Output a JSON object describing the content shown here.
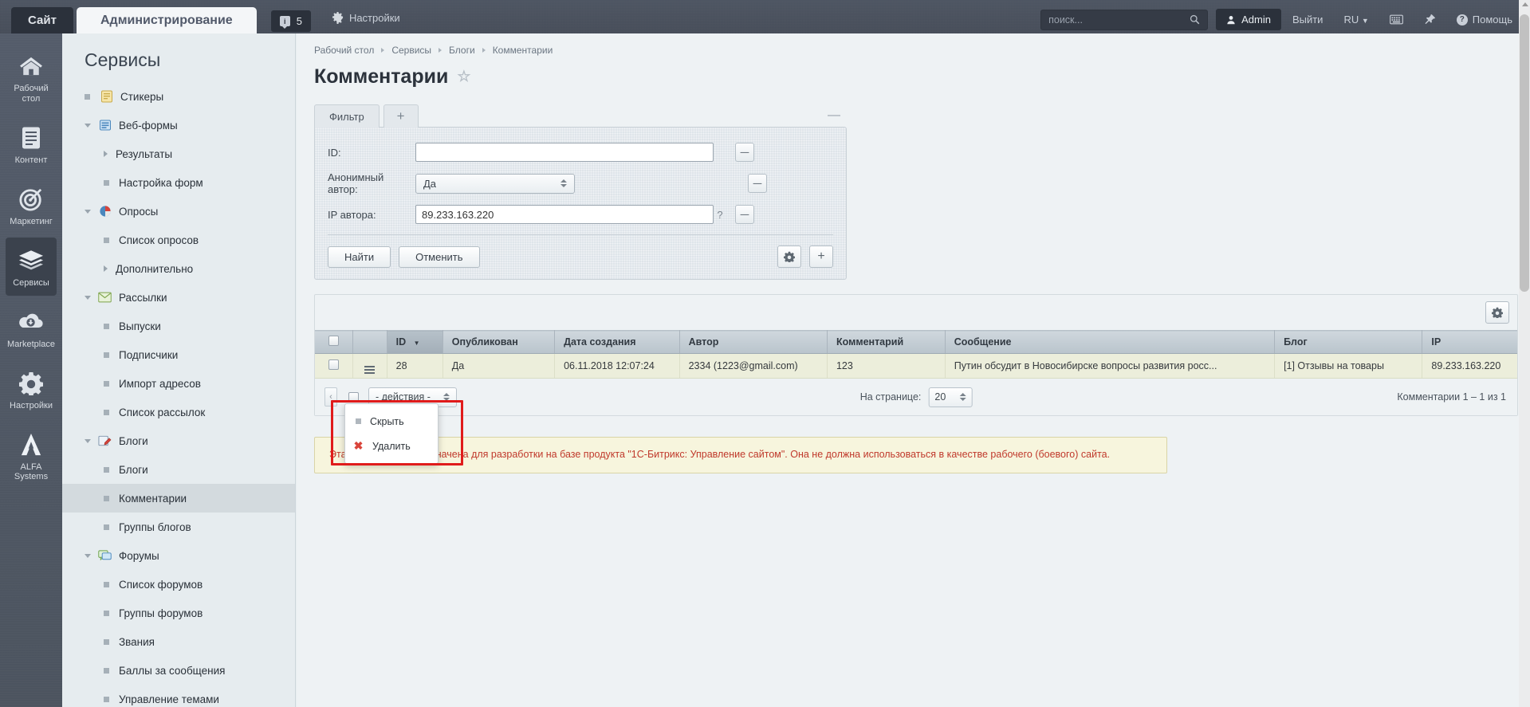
{
  "header": {
    "site_tab": "Сайт",
    "admin_tab": "Администрирование",
    "notif_count": "5",
    "settings_label": "Настройки",
    "search_placeholder": "поиск...",
    "user_label": "Admin",
    "logout_label": "Выйти",
    "lang_label": "RU",
    "help_label": "Помощь"
  },
  "rail": [
    {
      "label": "Рабочий стол",
      "icon": "home-icon"
    },
    {
      "label": "Контент",
      "icon": "document-icon"
    },
    {
      "label": "Маркетинг",
      "icon": "target-icon"
    },
    {
      "label": "Сервисы",
      "icon": "layers-icon"
    },
    {
      "label": "Marketplace",
      "icon": "cloud-download-icon"
    },
    {
      "label": "Настройки",
      "icon": "gear-icon"
    },
    {
      "label": "ALFA Systems",
      "icon": "alfa-logo-icon"
    }
  ],
  "menu": {
    "title": "Сервисы",
    "items": [
      {
        "label": "Стикеры",
        "level": 0,
        "marker": "bullet",
        "icon": "sticker-icon",
        "selected": false
      },
      {
        "label": "Веб-формы",
        "level": 0,
        "marker": "caret-down",
        "icon": "webform-icon",
        "selected": false
      },
      {
        "label": "Результаты",
        "level": 1,
        "marker": "caret",
        "icon": "",
        "selected": false
      },
      {
        "label": "Настройка форм",
        "level": 1,
        "marker": "bullet",
        "icon": "",
        "selected": false
      },
      {
        "label": "Опросы",
        "level": 0,
        "marker": "caret-down",
        "icon": "poll-icon",
        "selected": false
      },
      {
        "label": "Список опросов",
        "level": 1,
        "marker": "bullet",
        "icon": "",
        "selected": false
      },
      {
        "label": "Дополнительно",
        "level": 1,
        "marker": "caret",
        "icon": "",
        "selected": false
      },
      {
        "label": "Рассылки",
        "level": 0,
        "marker": "caret-down",
        "icon": "mail-icon",
        "selected": false
      },
      {
        "label": "Выпуски",
        "level": 1,
        "marker": "bullet",
        "icon": "",
        "selected": false
      },
      {
        "label": "Подписчики",
        "level": 1,
        "marker": "bullet",
        "icon": "",
        "selected": false
      },
      {
        "label": "Импорт адресов",
        "level": 1,
        "marker": "bullet",
        "icon": "",
        "selected": false
      },
      {
        "label": "Список рассылок",
        "level": 1,
        "marker": "bullet",
        "icon": "",
        "selected": false
      },
      {
        "label": "Блоги",
        "level": 0,
        "marker": "caret-down",
        "icon": "blog-icon",
        "selected": false
      },
      {
        "label": "Блоги",
        "level": 1,
        "marker": "bullet",
        "icon": "",
        "selected": false
      },
      {
        "label": "Комментарии",
        "level": 1,
        "marker": "bullet",
        "icon": "",
        "selected": true
      },
      {
        "label": "Группы блогов",
        "level": 1,
        "marker": "bullet",
        "icon": "",
        "selected": false
      },
      {
        "label": "Форумы",
        "level": 0,
        "marker": "caret-down",
        "icon": "forum-icon",
        "selected": false
      },
      {
        "label": "Список форумов",
        "level": 1,
        "marker": "bullet",
        "icon": "",
        "selected": false
      },
      {
        "label": "Группы форумов",
        "level": 1,
        "marker": "bullet",
        "icon": "",
        "selected": false
      },
      {
        "label": "Звания",
        "level": 1,
        "marker": "bullet",
        "icon": "",
        "selected": false
      },
      {
        "label": "Баллы за сообщения",
        "level": 1,
        "marker": "bullet",
        "icon": "",
        "selected": false
      },
      {
        "label": "Управление темами",
        "level": 1,
        "marker": "bullet",
        "icon": "",
        "selected": false
      }
    ]
  },
  "breadcrumb": [
    "Рабочий стол",
    "Сервисы",
    "Блоги",
    "Комментарии"
  ],
  "page": {
    "title": "Комментарии"
  },
  "filter": {
    "tab_label": "Фильтр",
    "add_tab_label": "+",
    "collapse_label": "—",
    "fields": [
      {
        "label": "ID:",
        "type": "text",
        "value": "",
        "has_help": false
      },
      {
        "label": "Анонимный автор:",
        "type": "select",
        "value": "Да",
        "has_help": false
      },
      {
        "label": "IP автора:",
        "type": "text",
        "value": "89.233.163.220",
        "has_help": true,
        "help_label": "?"
      }
    ],
    "find_label": "Найти",
    "cancel_label": "Отменить",
    "settings_icon_label": "gear-icon",
    "add_icon_label": "+"
  },
  "grid": {
    "settings_icon": "gear-icon",
    "columns": [
      "",
      "",
      "ID",
      "Опубликован",
      "Дата создания",
      "Автор",
      "Комментарий",
      "Сообщение",
      "Блог",
      "IP"
    ],
    "sorted_column": "ID",
    "sort_dir": "desc",
    "rows": [
      {
        "id": "28",
        "published": "Да",
        "created": "06.11.2018 12:07:24",
        "author": "2334 (1223@gmail.com)",
        "comment": "123",
        "message": "Путин обсудит в Новосибирске вопросы развития росс...",
        "blog": "[1] Отзывы на товары",
        "ip": "89.233.163.220"
      }
    ],
    "actions_label": "- действия -",
    "prev_label": "‹",
    "perpage_label": "На странице:",
    "perpage_value": "20",
    "total_label": "Комментарии 1 – 1 из 1"
  },
  "context_menu": {
    "items": [
      {
        "label": "Скрыть",
        "icon": "hide-dot-icon"
      },
      {
        "label": "Удалить",
        "icon": "delete-x-icon"
      }
    ]
  },
  "warning": {
    "text": "Эта установка предназначена для разработки на базе продукта \"1С-Битрикс: Управление сайтом\". Она не должна использоваться в качестве рабочего (боевого) сайта."
  },
  "colors": {
    "header_bg": "#49505c",
    "rail_bg": "#525a68",
    "menu_bg": "#e6ecef",
    "row_bg": "#eceedb",
    "link": "#436a9c",
    "warning_text": "#c0392b",
    "highlight_border": "#e01b1b"
  }
}
